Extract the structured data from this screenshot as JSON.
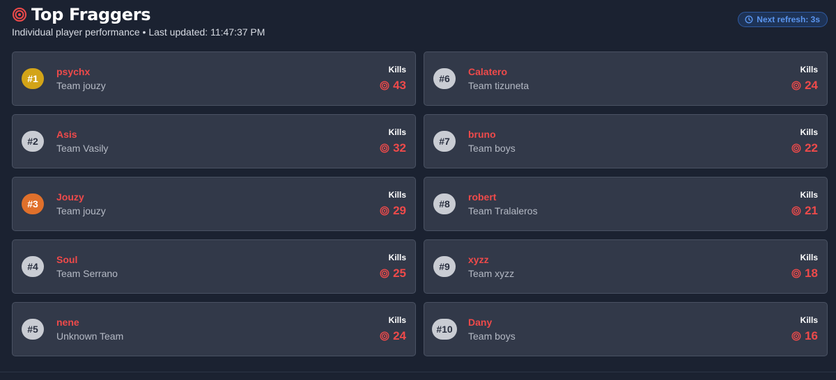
{
  "header": {
    "title": "Top Fraggers",
    "subtitle": "Individual player performance • Last updated: 11:47:37 PM",
    "refresh": "Next refresh: 3s",
    "icon": "target-icon"
  },
  "colors": {
    "background": "#1b2231",
    "card": "#323949",
    "accent_red": "#ef4a4a",
    "gold": "#d3a418",
    "bronze": "#e0702b",
    "refresh_blue": "#5b95ee"
  },
  "kills_label": "Kills",
  "players": [
    {
      "rank": "#1",
      "name": "psychx",
      "team": "Team jouzy",
      "kills": "43"
    },
    {
      "rank": "#6",
      "name": "Calatero",
      "team": "Team tizuneta",
      "kills": "24"
    },
    {
      "rank": "#2",
      "name": "Asis",
      "team": "Team Vasily",
      "kills": "32"
    },
    {
      "rank": "#7",
      "name": "bruno",
      "team": "Team boys",
      "kills": "22"
    },
    {
      "rank": "#3",
      "name": "Jouzy",
      "team": "Team jouzy",
      "kills": "29"
    },
    {
      "rank": "#8",
      "name": "robert",
      "team": "Team Tralaleros",
      "kills": "21"
    },
    {
      "rank": "#4",
      "name": "Soul",
      "team": "Team Serrano",
      "kills": "25"
    },
    {
      "rank": "#9",
      "name": "xyzz",
      "team": "Team xyzz",
      "kills": "18"
    },
    {
      "rank": "#5",
      "name": "nene",
      "team": "Unknown Team",
      "kills": "24"
    },
    {
      "rank": "#10",
      "name": "Dany",
      "team": "Team boys",
      "kills": "16"
    }
  ]
}
